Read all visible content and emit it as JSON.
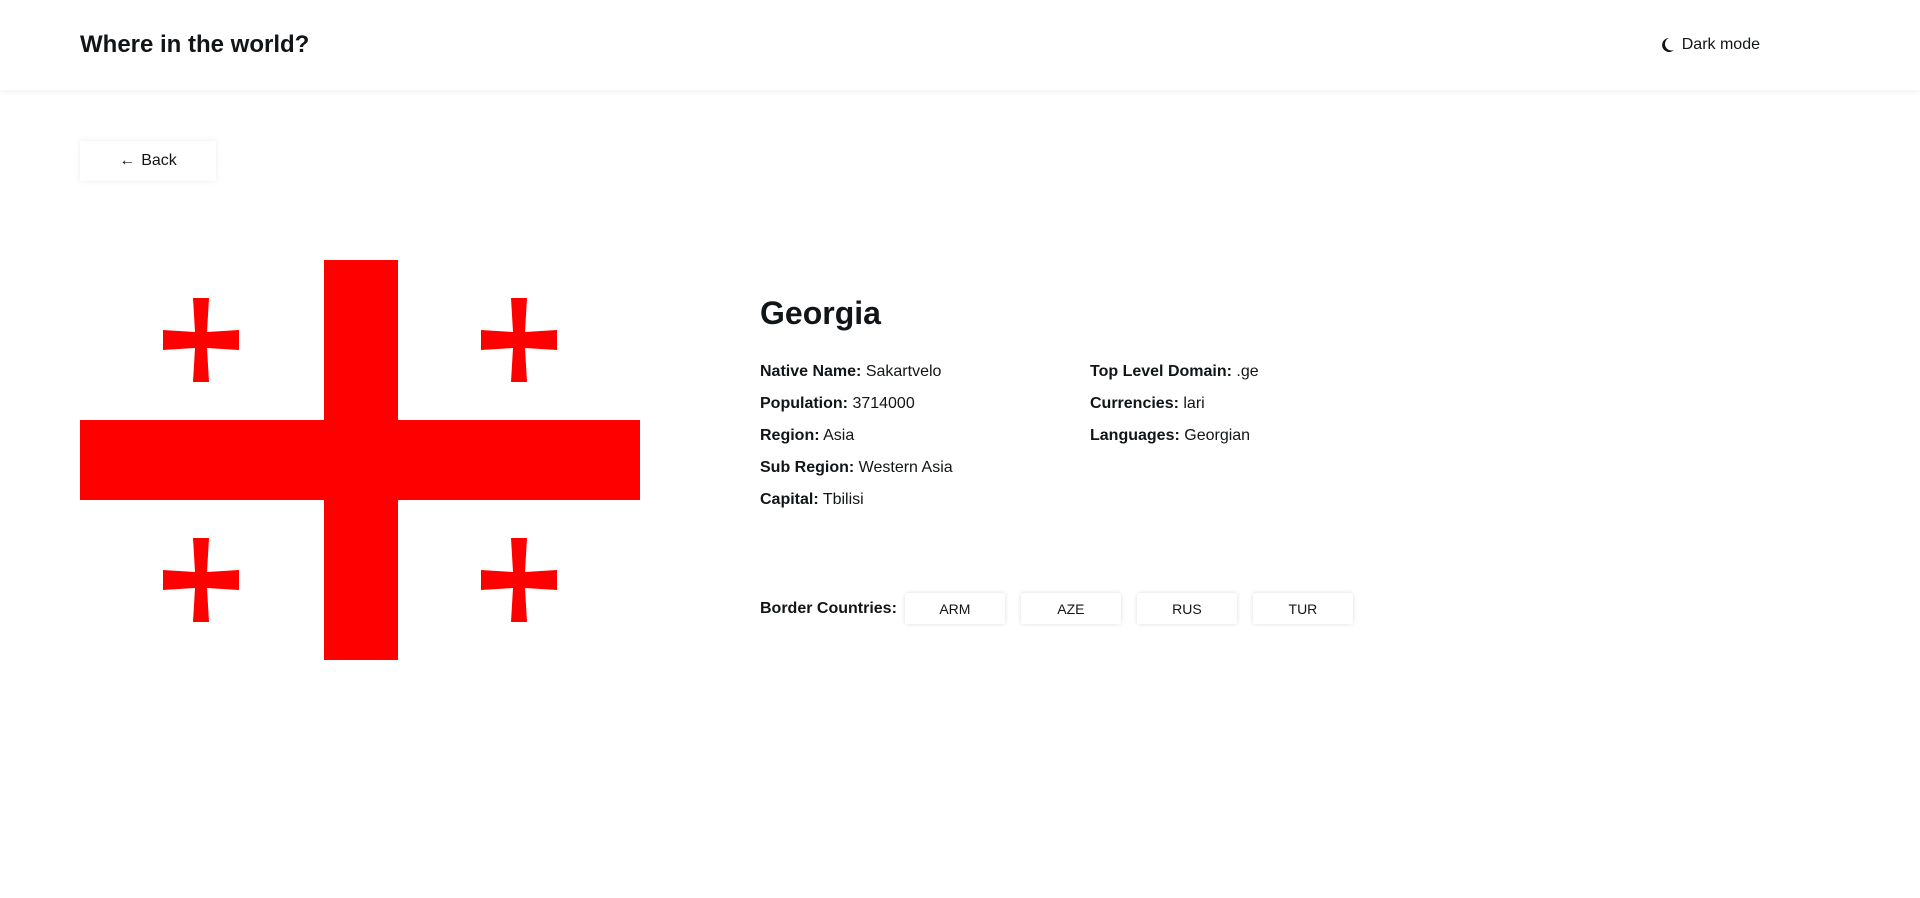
{
  "header": {
    "title": "Where in the world?",
    "theme_toggle_label": "Dark mode",
    "theme_icon": "moon-icon"
  },
  "back_button": {
    "arrow": "←",
    "label": "Back"
  },
  "flag": {
    "icon": "georgia-flag",
    "colors": {
      "background": "#ffffff",
      "cross": "#ff0000"
    }
  },
  "country": {
    "name": "Georgia",
    "details_left": [
      {
        "label": "Native Name:",
        "value": "Sakartvelo"
      },
      {
        "label": "Population:",
        "value": "3714000"
      },
      {
        "label": "Region:",
        "value": "Asia"
      },
      {
        "label": "Sub Region:",
        "value": "Western Asia"
      },
      {
        "label": "Capital:",
        "value": "Tbilisi"
      }
    ],
    "details_right": [
      {
        "label": "Top Level Domain:",
        "value": ".ge"
      },
      {
        "label": "Currencies:",
        "value": "lari"
      },
      {
        "label": "Languages:",
        "value": "Georgian"
      }
    ],
    "borders_label": "Border Countries:",
    "borders": [
      "ARM",
      "AZE",
      "RUS",
      "TUR"
    ]
  }
}
